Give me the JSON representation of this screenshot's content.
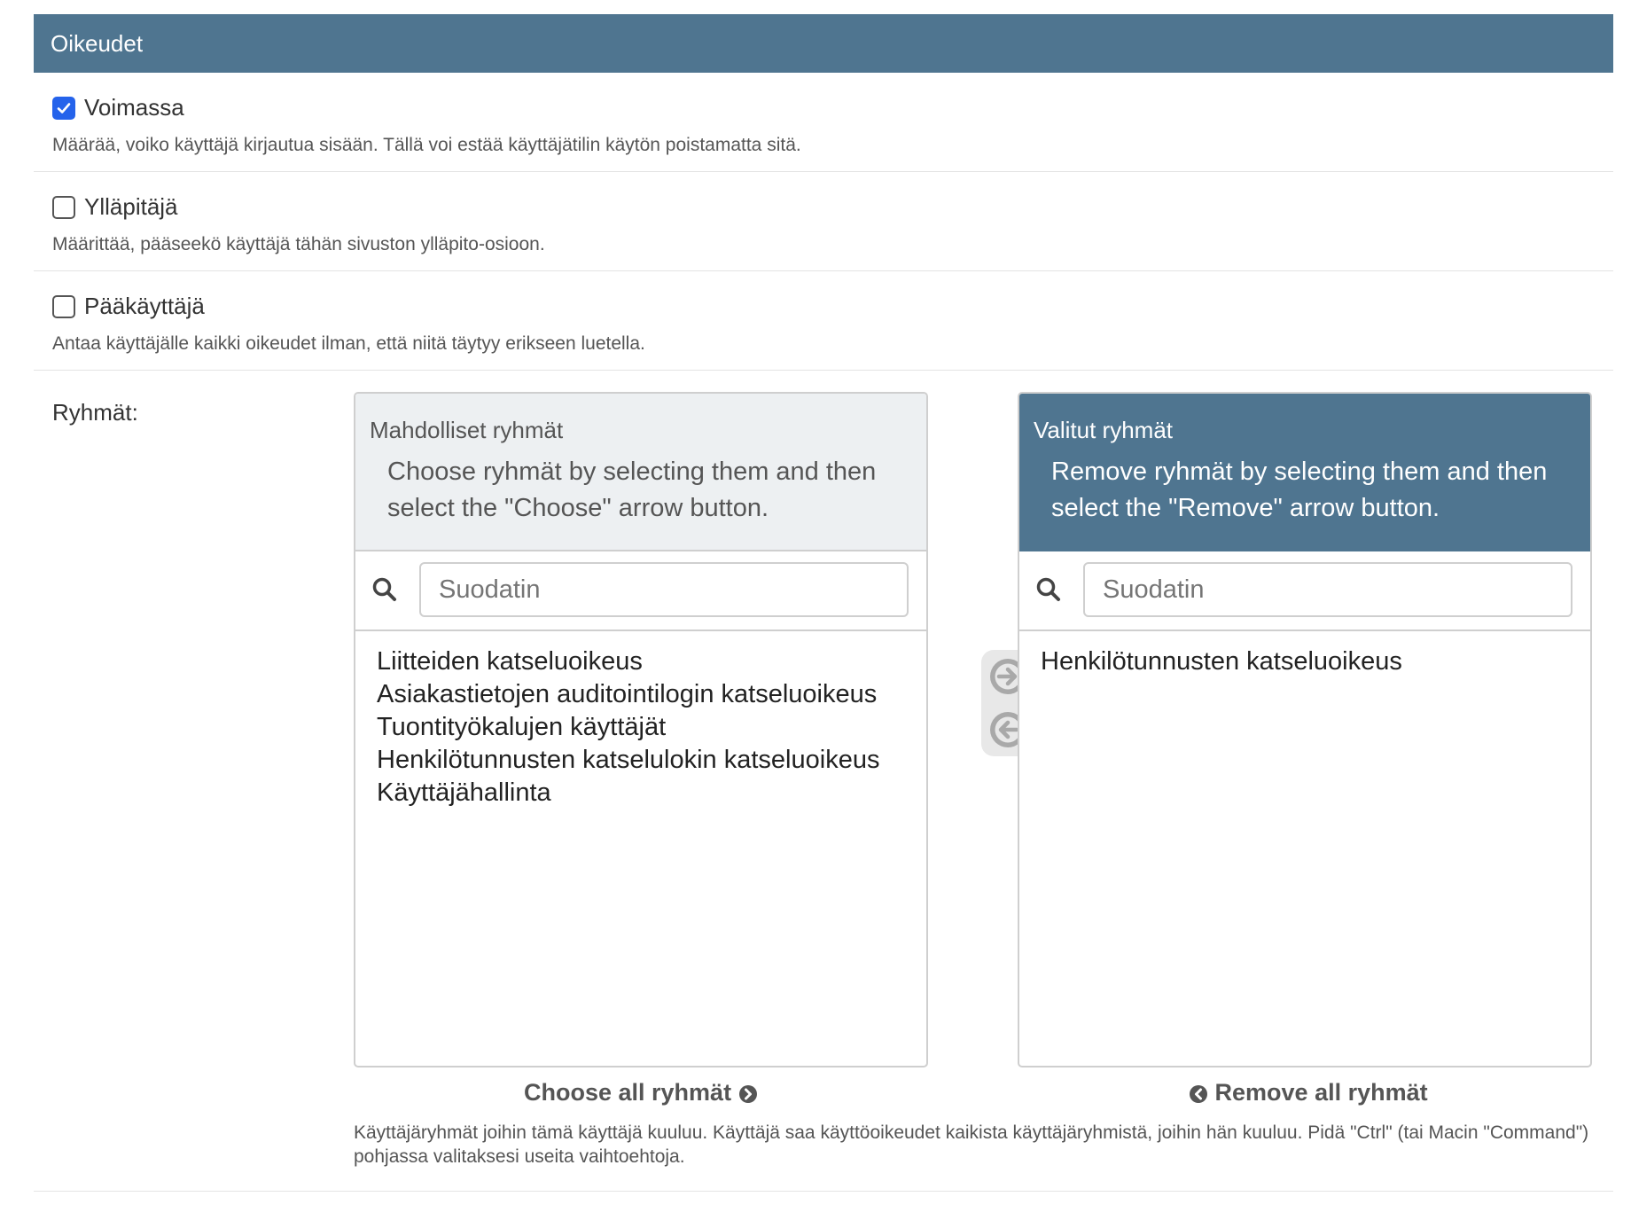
{
  "section": {
    "title": "Oikeudet"
  },
  "checkboxes": [
    {
      "label": "Voimassa",
      "checked": true,
      "help": "Määrää, voiko käyttäjä kirjautua sisään. Tällä voi estää käyttäjätilin käytön poistamatta sitä."
    },
    {
      "label": "Ylläpitäjä",
      "checked": false,
      "help": "Määrittää, pääseekö käyttäjä tähän sivuston ylläpito-osioon."
    },
    {
      "label": "Pääkäyttäjä",
      "checked": false,
      "help": "Antaa käyttäjälle kaikki oikeudet ilman, että niitä täytyy erikseen luetella."
    }
  ],
  "groups": {
    "label": "Ryhmät:",
    "available": {
      "title": "Mahdolliset ryhmät",
      "help": "Choose ryhmät by selecting them and then select the \"Choose\" arrow button.",
      "filter_placeholder": "Suodatin",
      "options": [
        "Liitteiden katseluoikeus",
        "Asiakastietojen auditointilogin katseluoikeus",
        "Tuontityökalujen käyttäjät",
        "Henkilötunnusten katselulokin katseluoikeus",
        "Käyttäjähallinta"
      ]
    },
    "chosen": {
      "title": "Valitut ryhmät",
      "help": "Remove ryhmät by selecting them and then select the \"Remove\" arrow button.",
      "filter_placeholder": "Suodatin",
      "options": [
        "Henkilötunnusten katseluoikeus"
      ]
    },
    "choose_all": "Choose all ryhmät",
    "remove_all": "Remove all ryhmät",
    "help": "Käyttäjäryhmät joihin tämä käyttäjä kuuluu. Käyttäjä saa käyttöoikeudet kaikista käyttäjäryhmistä, joihin hän kuuluu. Pidä \"Ctrl\" (tai Macin \"Command\") pohjassa valitaksesi useita vaihtoehtoja."
  },
  "icons": {
    "checked_color": "#2563eb",
    "header_color": "#4f7590",
    "choose": "arrow-right-circle-icon",
    "remove": "arrow-left-circle-icon",
    "search": "search-icon"
  }
}
